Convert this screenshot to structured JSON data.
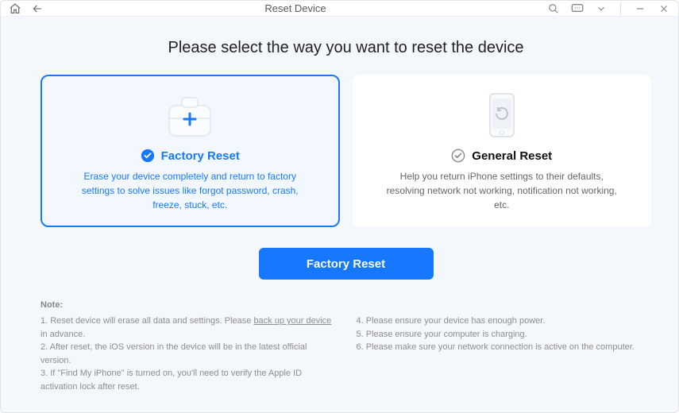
{
  "titlebar": {
    "title": "Reset Device"
  },
  "heading": "Please select the way you want to reset the device",
  "cards": {
    "factory": {
      "title": "Factory Reset",
      "desc": "Erase your device completely and return to factory settings to solve issues like forgot password, crash, freeze, stuck, etc."
    },
    "general": {
      "title": "General Reset",
      "desc": "Help you return iPhone settings to their defaults, resolving network not working, notification not working, etc."
    }
  },
  "primary_button": "Factory Reset",
  "notes": {
    "title": "Note:",
    "left": {
      "n1a": "1. Reset device will erase all data and settings. Please ",
      "n1link": "back up your device",
      "n1b": " in advance.",
      "n2": "2. After reset, the iOS version in the device will be in the latest official version.",
      "n3": "3. If \"Find My iPhone\" is turned on, you'll need to verify the Apple ID activation lock after reset."
    },
    "right": {
      "n4": "4. Please ensure your device has enough power.",
      "n5": "5. Please ensure your computer is charging.",
      "n6": "6. Please make sure your network connection is active on the computer."
    }
  },
  "icon_names": {
    "home": "home-icon",
    "back": "back-icon",
    "search": "search-icon",
    "feedback": "feedback-icon",
    "chevron": "chevron-down-icon",
    "minimize": "minimize-icon",
    "close": "close-icon",
    "toolkit": "toolkit-icon",
    "phone": "phone-refresh-icon",
    "check": "check-icon",
    "check_filled": "check-filled-icon"
  },
  "colors": {
    "accent": "#1677ff",
    "panel_bg": "#f4f7fb"
  }
}
